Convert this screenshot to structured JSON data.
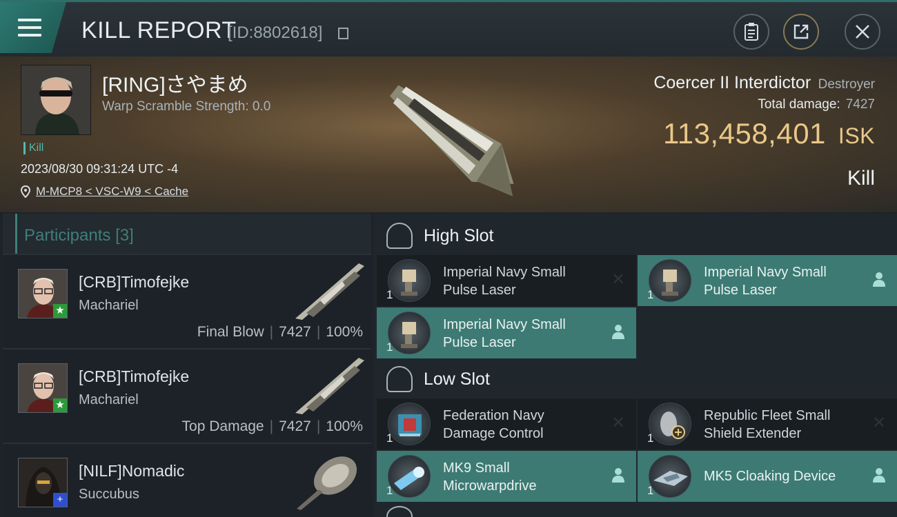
{
  "header": {
    "title": "KILL REPORT",
    "report_id": "[ID:8802618]"
  },
  "victim": {
    "name": "[RING]さやまめ",
    "warp_scramble": "Warp Scramble Strength: 0.0",
    "tag": "Kill",
    "datetime": "2023/08/30 09:31:24 UTC -4",
    "location": "M-MCP8 < VSC-W9 < Cache",
    "ship_name": "Coercer II Interdictor",
    "ship_class": "Destroyer",
    "total_damage_label": "Total damage:",
    "total_damage_value": "7427",
    "isk_value": "113,458,401",
    "isk_unit": "ISK",
    "result": "Kill"
  },
  "participants": {
    "label": "Participants",
    "count": "[3]",
    "rows": [
      {
        "name": "[CRB]Timofejke",
        "ship": "Machariel",
        "role": "Final Blow",
        "damage": "7427",
        "percent": "100%",
        "badge": "★",
        "badge_color": "#2c9a3a"
      },
      {
        "name": "[CRB]Timofejke",
        "ship": "Machariel",
        "role": "Top Damage",
        "damage": "7427",
        "percent": "100%",
        "badge": "★",
        "badge_color": "#2c9a3a"
      },
      {
        "name": "[NILF]Nomadic",
        "ship": "Succubus",
        "role": "",
        "damage": "",
        "percent": "",
        "badge": "+",
        "badge_color": "#2f4fd0"
      }
    ]
  },
  "fittings": {
    "high_slot_label": "High Slot",
    "low_slot_label": "Low Slot",
    "high": [
      {
        "line1": "Imperial Navy Small",
        "line2": "Pulse Laser",
        "qty": "1",
        "state": "destroyed",
        "icon": "laser-icon"
      },
      {
        "line1": "Imperial Navy Small",
        "line2": "Pulse Laser",
        "qty": "1",
        "state": "dropped",
        "icon": "laser-icon"
      },
      {
        "line1": "Imperial Navy Small",
        "line2": "Pulse Laser",
        "qty": "1",
        "state": "dropped",
        "icon": "laser-icon"
      }
    ],
    "low": [
      {
        "line1": "Federation Navy",
        "line2": "Damage Control",
        "qty": "1",
        "state": "destroyed",
        "icon": "damage-control-icon"
      },
      {
        "line1": "Republic Fleet Small",
        "line2": "Shield Extender",
        "qty": "1",
        "state": "destroyed",
        "icon": "shield-extender-icon"
      },
      {
        "line1": "MK9 Small",
        "line2": "Microwarpdrive",
        "qty": "1",
        "state": "dropped",
        "icon": "microwarpdrive-icon"
      },
      {
        "line1": "MK5 Cloaking Device",
        "line2": "",
        "qty": "1",
        "state": "dropped",
        "icon": "cloaking-device-icon"
      }
    ]
  },
  "colors": {
    "accent": "#3d7a74",
    "isk": "#e9c888"
  }
}
